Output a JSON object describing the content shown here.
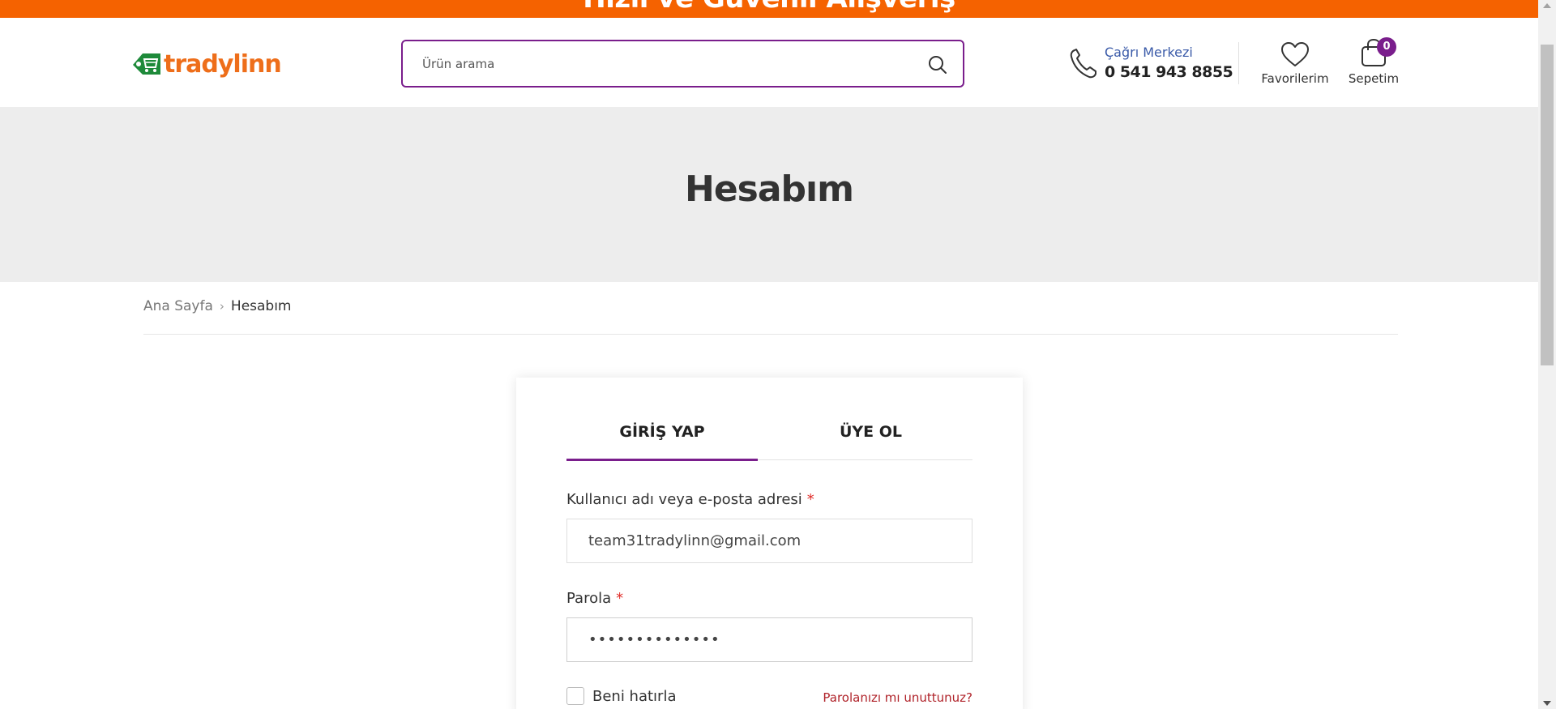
{
  "banner": {
    "text": "Hızlı ve Güvenli Alışveriş"
  },
  "header": {
    "brand": "tradylinn",
    "search": {
      "placeholder": "Ürün arama",
      "value": ""
    },
    "call_center": {
      "label": "Çağrı Merkezi",
      "number": "0 541 943 8855"
    },
    "favorites_label": "Favorilerim",
    "cart_label": "Sepetim",
    "cart_count": "0"
  },
  "page": {
    "title": "Hesabım"
  },
  "breadcrumb": {
    "home": "Ana Sayfa",
    "separator": "›",
    "current": "Hesabım"
  },
  "login": {
    "tabs": [
      {
        "label": "GİRİŞ YAP",
        "active": true
      },
      {
        "label": "ÜYE OL",
        "active": false
      }
    ],
    "username_label": "Kullanıcı adı veya e-posta adresi",
    "username_value": "team31tradylinn@gmail.com",
    "password_label": "Parola",
    "password_value": "••••••••••••••",
    "required_mark": "*",
    "remember_label": "Beni hatırla",
    "forgot_link": "Parolanızı mı unuttunuz?"
  },
  "colors": {
    "brand_orange": "#f56200",
    "accent_purple": "#7a1e8c",
    "link_red": "#b0232a"
  }
}
